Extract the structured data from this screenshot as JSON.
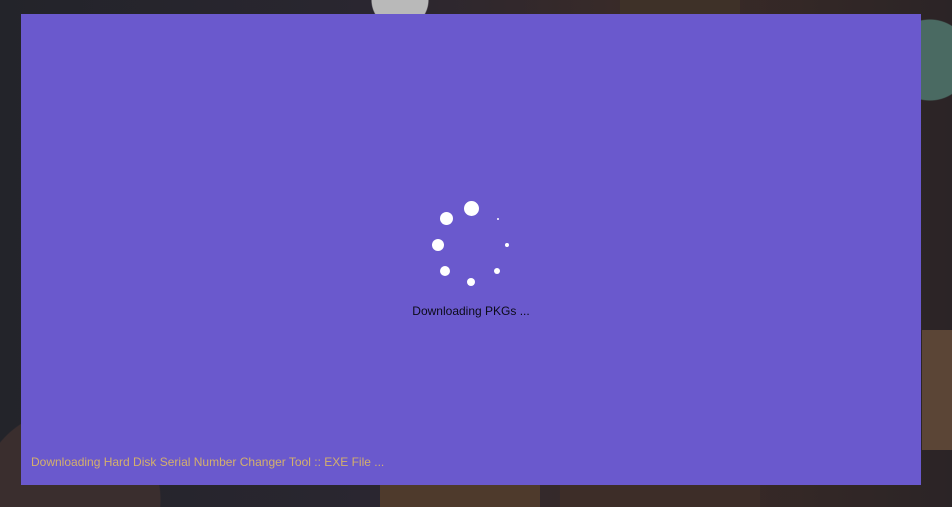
{
  "installer": {
    "loading_text": "Downloading PKGs ...",
    "status_text": "Downloading Hard Disk Serial Number Changer Tool :: EXE File ...",
    "background_color": "#6a59cd",
    "status_color": "#d4b06c",
    "spinner_icon": "loading-spinner-icon"
  }
}
